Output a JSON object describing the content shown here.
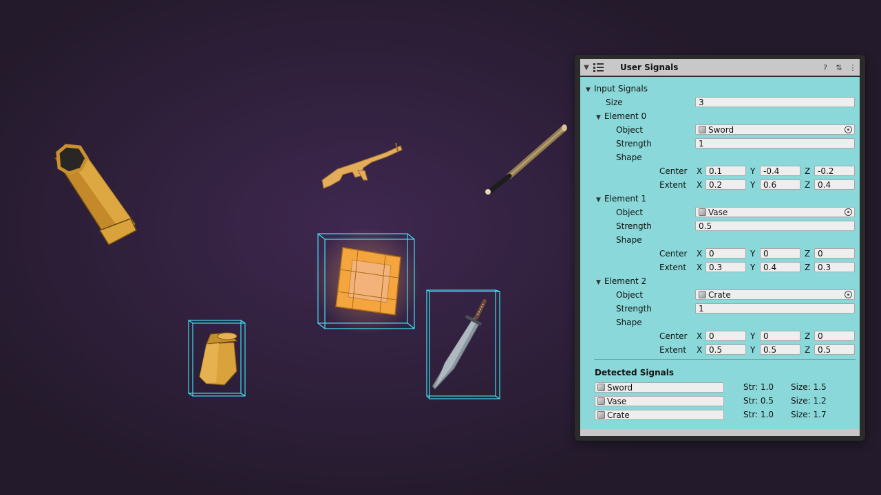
{
  "window": {
    "title": "User Signals",
    "header_icons": [
      "fold-arrow-icon",
      "list-icon",
      "help-icon",
      "settings-icon",
      "more-icon"
    ],
    "help_glyph": "?",
    "settings_glyph": "⇅",
    "more_glyph": "⋮"
  },
  "input": {
    "label": "Input Signals",
    "size_label": "Size",
    "size_value": "3",
    "labels": {
      "object": "Object",
      "strength": "Strength",
      "shape": "Shape",
      "center": "Center",
      "extent": "Extent",
      "x": "X",
      "y": "Y",
      "z": "Z"
    },
    "elements": [
      {
        "label": "Element 0",
        "object": "Sword",
        "strength": "1",
        "center": {
          "x": "0.1",
          "y": "-0.4",
          "z": "-0.2"
        },
        "extent": {
          "x": "0.2",
          "y": "0.6",
          "z": "0.4"
        }
      },
      {
        "label": "Element 1",
        "object": "Vase",
        "strength": "0.5",
        "center": {
          "x": "0",
          "y": "0",
          "z": "0"
        },
        "extent": {
          "x": "0.3",
          "y": "0.4",
          "z": "0.3"
        }
      },
      {
        "label": "Element 2",
        "object": "Crate",
        "strength": "1",
        "center": {
          "x": "0",
          "y": "0",
          "z": "0"
        },
        "extent": {
          "x": "0.5",
          "y": "0.5",
          "z": "0.5"
        }
      }
    ]
  },
  "detected": {
    "label": "Detected Signals",
    "rows": [
      {
        "name": "Sword",
        "str": "Str: 1.0",
        "size": "Size: 1.5"
      },
      {
        "name": "Vase",
        "str": "Str: 0.5",
        "size": "Size: 1.2"
      },
      {
        "name": "Crate",
        "str": "Str: 1.0",
        "size": "Size: 1.7"
      }
    ]
  },
  "colors": {
    "panel_bg": "#8ad8d9",
    "header_bg": "#c8c8c8",
    "selection_box": "#3fe0f0",
    "gold": "#d9a23a"
  }
}
